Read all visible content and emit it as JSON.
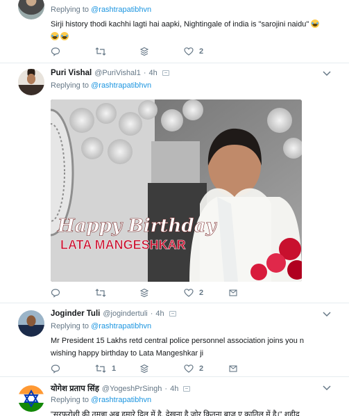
{
  "tweets": [
    {
      "text": "Sirji history thodi kachhi lagti hai aapki, Nightingale of india is \"sarojini naidu\"",
      "actions": {
        "reply_count": "",
        "retweet_count": "",
        "like_count": "2"
      }
    },
    {
      "name": "Puri Vishal",
      "handle": "@PuriVishal1",
      "time": "4h",
      "replying_prefix": "Replying to",
      "replying_to": "@rashtrapatibhvn",
      "image": {
        "line1": "Happy Birthday",
        "line2": "LATA MANGESHKAR"
      },
      "actions": {
        "reply_count": "",
        "retweet_count": "",
        "like_count": "2"
      }
    },
    {
      "name": "Joginder Tuli",
      "handle": "@jogindertuli",
      "time": "4h",
      "replying_prefix": "Replying to",
      "replying_to": "@rashtrapatibhvn",
      "text_line1": "Mr President 15 Lakhs retd central police personnel association joins you n",
      "text_line2": "wishing happy birthday to Lata Mangeshkar ji",
      "actions": {
        "reply_count": "",
        "retweet_count": "1",
        "like_count": "2"
      }
    },
    {
      "name": "योगेश प्रताप सिंह",
      "handle": "@YogeshPrSingh",
      "time": "4h",
      "replying_prefix": "Replying to",
      "replying_to": "@rashtrapatibhvn",
      "text_partial": "\"सरफरोशी की तमन्ना अब हमारे दिल में है, देखना है ज़ोर कितना बाज़ु ए कातिल में है।\" शहीद"
    }
  ],
  "top_reply": {
    "replying_prefix": "Replying to",
    "replying_to": "@rashtrapatibhvn"
  },
  "colors": {
    "link": "#1b95e0",
    "muted": "#657786",
    "border": "#e6ecf0"
  },
  "icons": [
    "reply-icon",
    "retweet-icon",
    "direct-message-icon",
    "heart-icon",
    "caret-down-icon"
  ]
}
